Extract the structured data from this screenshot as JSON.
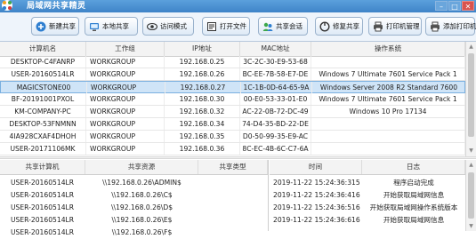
{
  "app": {
    "title": "局域网共享精灵"
  },
  "window": {
    "minimize": "–",
    "maximize": "□",
    "close": "✕"
  },
  "toolbar": [
    {
      "label": "新建共享",
      "icon": "new-share-icon"
    },
    {
      "label": "本地共享",
      "icon": "local-share-icon"
    },
    {
      "label": "访问模式",
      "icon": "access-mode-icon"
    },
    {
      "label": "打开文件",
      "icon": "open-file-icon"
    },
    {
      "label": "共享会话",
      "icon": "share-session-icon"
    },
    {
      "label": "修复共享",
      "icon": "repair-share-icon"
    },
    {
      "label": "打印机管理",
      "icon": "printer-manage-icon"
    },
    {
      "label": "添加打印机",
      "icon": "add-printer-icon"
    }
  ],
  "computers": {
    "columns": [
      "计算机名",
      "工作组",
      "IP地址",
      "MAC地址",
      "操作系统"
    ],
    "rows": [
      [
        "DESKTOP-C4FANRP",
        "WORKGROUP",
        "192.168.0.25",
        "3C-2C-30-E9-53-68",
        ""
      ],
      [
        "USER-20160514LR",
        "WORKGROUP",
        "192.168.0.26",
        "BC-EE-7B-58-E7-DE",
        "Windows 7 Ultimate 7601 Service Pack 1"
      ],
      [
        "MAGICSTONE00",
        "WORKGROUP",
        "192.168.0.27",
        "1C-1B-0D-64-65-9A",
        "Windows Server 2008 R2 Standard 7600"
      ],
      [
        "BF-20191001PXOL",
        "WORKGROUP",
        "192.168.0.30",
        "00-E0-53-33-01-E0",
        "Windows 7 Ultimate 7601 Service Pack 1"
      ],
      [
        "KM-COMPANY-PC",
        "WORKGROUP",
        "192.168.0.32",
        "AC-22-0B-72-DC-49",
        "Windows 10 Pro 17134"
      ],
      [
        "DESKTOP-53FNMNN",
        "WORKGROUP",
        "192.168.0.34",
        "74-D4-35-BD-22-DE",
        ""
      ],
      [
        "4IA928CXAF4DHOH",
        "WORKGROUP",
        "192.168.0.35",
        "D0-50-99-35-E9-AC",
        ""
      ],
      [
        "USER-20171106MK",
        "WORKGROUP",
        "192.168.0.36",
        "8C-EC-4B-6C-C7-6A",
        ""
      ]
    ],
    "selected_index": 2
  },
  "shares": {
    "columns": [
      "共享计算机",
      "共享资源",
      "共享类型"
    ],
    "rows": [
      [
        "USER-20160514LR",
        "\\\\192.168.0.26\\ADMIN$",
        ""
      ],
      [
        "USER-20160514LR",
        "\\\\192.168.0.26\\C$",
        ""
      ],
      [
        "USER-20160514LR",
        "\\\\192.168.0.26\\D$",
        ""
      ],
      [
        "USER-20160514LR",
        "\\\\192.168.0.26\\E$",
        ""
      ],
      [
        "USER-20160514LR",
        "\\\\192.168.0.26\\F$",
        ""
      ]
    ]
  },
  "log": {
    "columns": [
      "时间",
      "日志"
    ],
    "rows": [
      [
        "2019-11-22 15:24:36:315",
        "程序启动完成"
      ],
      [
        "2019-11-22 15:24:36:416",
        "开始获取局域网信息"
      ],
      [
        "2019-11-22 15:24:36:516",
        "开始获取局域网操作系统版本"
      ],
      [
        "2019-11-22 15:24:36:616",
        "开始获取局域网信息"
      ]
    ]
  },
  "colors": {
    "title_bar": "#4a90d4",
    "selected_row": "#cfe4f7",
    "icon_blue": "#2f7fd0",
    "icon_orange": "#f08a1c",
    "icon_green": "#3da84a",
    "icon_red": "#d83b3b"
  }
}
